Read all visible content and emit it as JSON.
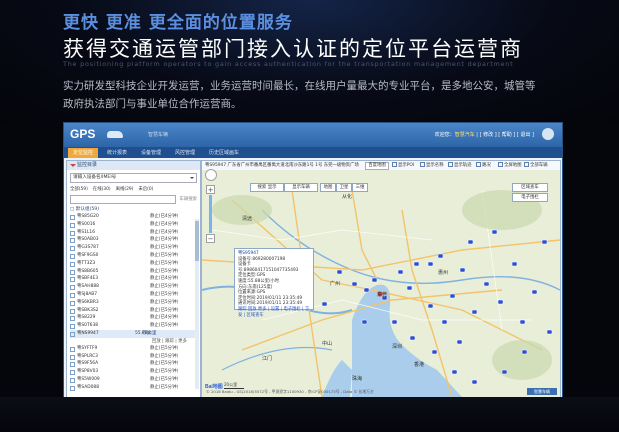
{
  "promo": {
    "headline": "更快 更准 更全面的位置服务",
    "title": "获得交通运管部门接入认证的定位平台运营商",
    "subtitle_en": "The positioning platform operators to gain access authentication for the transportation management department",
    "description": "实力研发型科技企业开发运营，业务运营时间最长，在线用户量最大的专业平台，是多地公安，城管等政府执法部门与事业单位合作运营商。"
  },
  "app": {
    "logo": "GPS",
    "name": "智慧车辆",
    "top_info": "欢迎您：",
    "top_user": "智慧汽车",
    "top_links": "| [ 修改 ] [ 帮助 ] [ 退出 ]",
    "colors": {
      "titlebar": "#3a75ba",
      "navbar": "#1f4f8e",
      "active_tab": "#f1a83a",
      "marker": "#2d4fd6"
    }
  },
  "nav": {
    "tabs": [
      {
        "label": "定位监控",
        "active": true
      },
      {
        "label": "统计报表",
        "active": false
      },
      {
        "label": "设备管理",
        "active": false
      },
      {
        "label": "风控管理",
        "active": false
      },
      {
        "label": "历史区域画车",
        "active": false
      }
    ]
  },
  "left_panel": {
    "header": "监控目录",
    "select_value": "请输入设备名/IMEI号",
    "filters": [
      "全部(59)",
      "在线(30)",
      "离线(29)",
      "未启(0)"
    ],
    "search_placeholder": "车辆搜索",
    "group_label": "□ 默认组(59)",
    "vehicles": [
      {
        "plate": "粤S85G20",
        "status": "静止(已4分钟)"
      },
      {
        "plate": "粤S0016",
        "status": "静止(已4分钟)"
      },
      {
        "plate": "粤S1L16",
        "status": "静止(已4分钟)"
      },
      {
        "plate": "粤S0AB03",
        "status": "静止(已4分钟)"
      },
      {
        "plate": "粤G3S787",
        "status": "静止(已1分钟)"
      },
      {
        "plate": "粤SF9GS0",
        "status": "静止(已5分钟)"
      },
      {
        "plate": "粤TT3Z3",
        "status": "静止(已5分钟)"
      },
      {
        "plate": "粤S8B605",
        "status": "静止(已5分钟)"
      },
      {
        "plate": "粤SBF4E3",
        "status": "静止(已4分钟)"
      },
      {
        "plate": "粤SAH888",
        "status": "静止(已5分钟)"
      },
      {
        "plate": "粤SJ8AB7",
        "status": "静止(已5分钟)"
      },
      {
        "plate": "粤S6KBR3",
        "status": "静止(已5分钟)"
      },
      {
        "plate": "粤SBK3S2",
        "status": "静止(已5分钟)"
      },
      {
        "plate": "粤S8229",
        "status": "静止(已4分钟)"
      },
      {
        "plate": "粤S0T638",
        "status": "静止(已5分钟)"
      }
    ],
    "selected": {
      "plate": "粤NS9947",
      "speed": "55.88公里",
      "status": "行驶",
      "actions": "回放 | 跟踪 | 更多"
    },
    "vehicles_after": [
      {
        "plate": "粤SYFTF9",
        "status": "静止(已5分钟)"
      },
      {
        "plate": "粤SPLRC3",
        "status": "静止(已5分钟)"
      },
      {
        "plate": "粤S9F56A",
        "status": "静止(已5分钟)"
      },
      {
        "plate": "粤SP8V03",
        "status": "静止(已5分钟)"
      },
      {
        "plate": "粤S5W009",
        "status": "静止(已5分钟)"
      },
      {
        "plate": "粤SAD088",
        "status": "静止(已5分钟)"
      }
    ]
  },
  "map": {
    "address": "粤S95947 广东省广州市番禺区番禺大道北南沙东路1号 1号 东莞一级物资广场",
    "map_type": "百度地图",
    "options": [
      "显示POI",
      "显示名称",
      "显示轨迹",
      "路况",
      "全屏地图",
      "全部车辆"
    ],
    "tools": [
      "搜索 显示",
      "显示车辆",
      "区域查车",
      "电子围栏"
    ],
    "layer_labels": [
      "地图",
      "卫星",
      "三维"
    ],
    "cities": [
      "从化",
      "清远",
      "广州",
      "佛山",
      "东莞",
      "中山",
      "惠州",
      "深圳",
      "江门",
      "珠海",
      "香港"
    ],
    "infobox": {
      "title": "粤S95947",
      "lines": [
        "设备号:869280007198",
        "设备卡号:89860417151047735493",
        "定位类型:GPS",
        "速度:55.88公里/小时",
        "方向:东南(125度)",
        "位置来源:GPS",
        "定位时间:2019/01/11 23:35:49",
        "通讯时间:2019/01/11 23:35:49"
      ],
      "actions": "跟踪 回放 更多 | 设置 | 电子围栏 | 下发 | 区域查车"
    },
    "scale": "20公里",
    "copyright": "© 2018 Baidu - GS(2018)5572号 - 甲测资字1100930 - 京ICP证030173号 - Data © 长地万方",
    "bottom_right": "智慧车辆"
  }
}
